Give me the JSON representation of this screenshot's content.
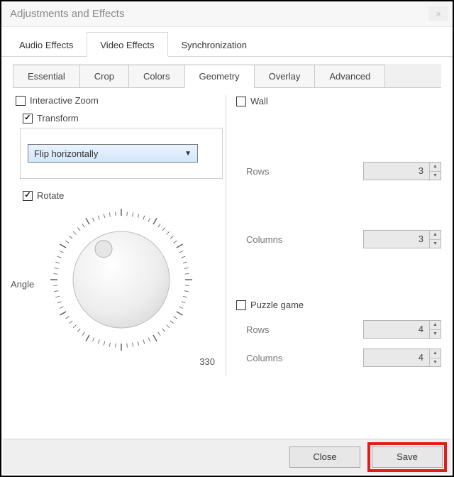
{
  "window": {
    "title": "Adjustments and Effects"
  },
  "main_tabs": {
    "audio": "Audio Effects",
    "video": "Video Effects",
    "sync": "Synchronization"
  },
  "sub_tabs": {
    "essential": "Essential",
    "crop": "Crop",
    "colors": "Colors",
    "geometry": "Geometry",
    "overlay": "Overlay",
    "advanced": "Advanced"
  },
  "left": {
    "interactive_zoom": "Interactive Zoom",
    "transform": "Transform",
    "transform_mode": "Flip horizontally",
    "rotate": "Rotate",
    "angle_label": "Angle",
    "angle_readout": "330"
  },
  "right": {
    "wall": {
      "label": "Wall",
      "rows_label": "Rows",
      "rows_value": "3",
      "cols_label": "Columns",
      "cols_value": "3"
    },
    "puzzle": {
      "label": "Puzzle game",
      "rows_label": "Rows",
      "rows_value": "4",
      "cols_label": "Columns",
      "cols_value": "4"
    }
  },
  "footer": {
    "close": "Close",
    "save": "Save"
  }
}
